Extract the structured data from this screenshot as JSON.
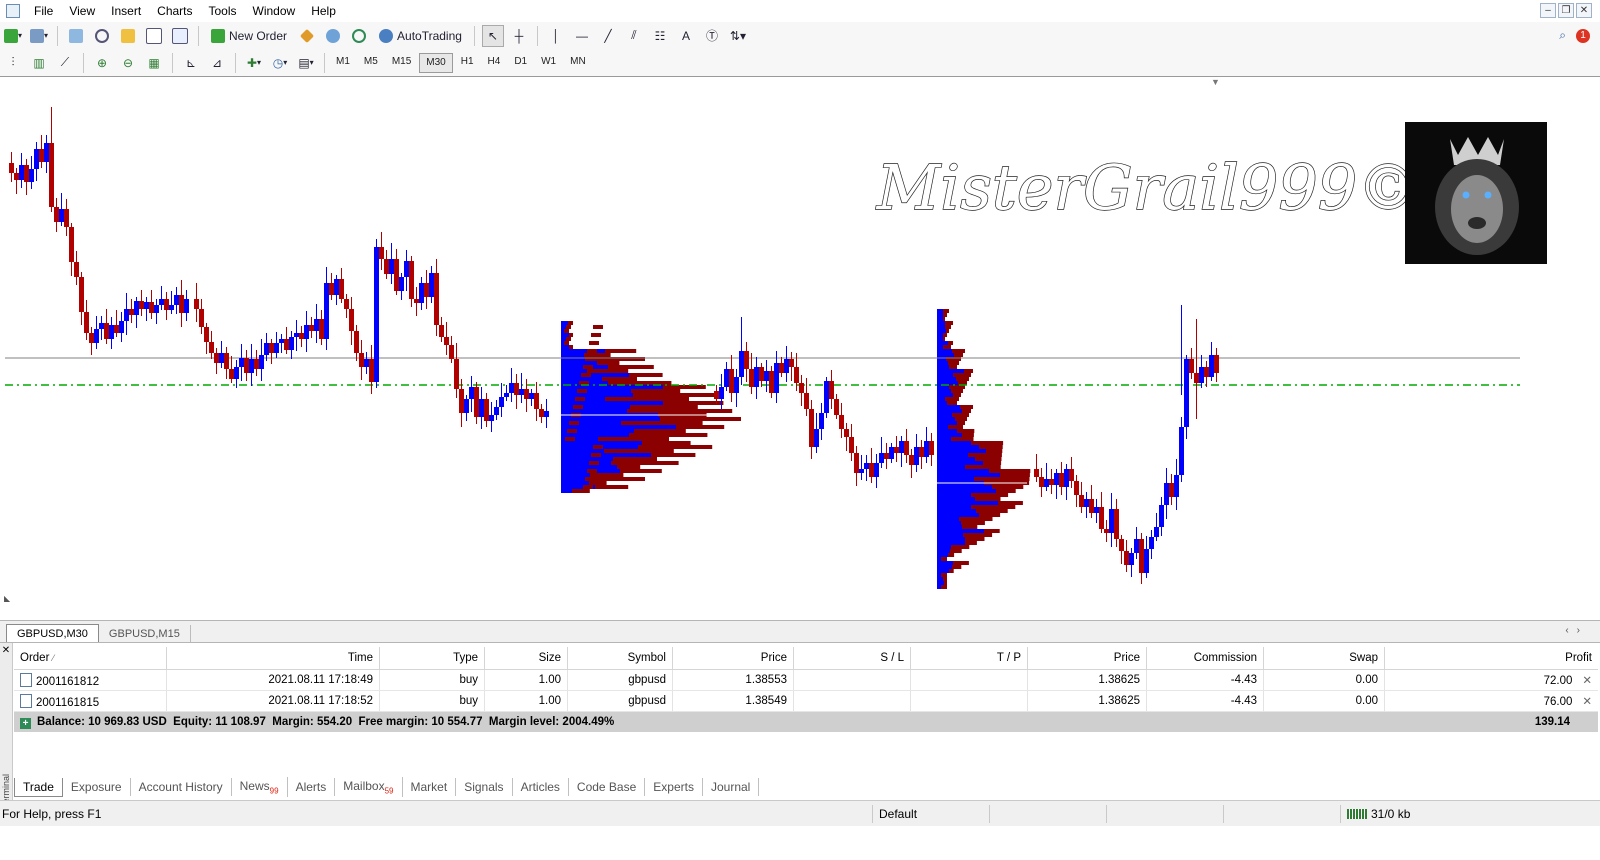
{
  "menu": {
    "items": [
      "File",
      "View",
      "Insert",
      "Charts",
      "Tools",
      "Window",
      "Help"
    ]
  },
  "toolbar": {
    "new_order_label": "New Order",
    "autotrading_label": "AutoTrading",
    "timeframes": [
      "M1",
      "M5",
      "M15",
      "M30",
      "H1",
      "H4",
      "D1",
      "W1",
      "MN"
    ],
    "active_timeframe": "M30",
    "notification_count": "1"
  },
  "chart": {
    "watermark_text": "MisterGrail999©",
    "logo": "lion-with-crown-icon",
    "colors": {
      "bull": "#0000ff",
      "bear": "#b00000",
      "profile_blue": "#0000ff",
      "profile_red": "#8b0000",
      "level_line": "#00aa00",
      "price_line": "#808080"
    }
  },
  "chart_tabs": [
    "GBPUSD,M30",
    "GBPUSD,M15"
  ],
  "terminal": {
    "side_label": "Terminal",
    "columns": [
      "Order",
      "Time",
      "Type",
      "Size",
      "Symbol",
      "Price",
      "S / L",
      "T / P",
      "Price",
      "Commission",
      "Swap",
      "Profit"
    ],
    "orders": [
      {
        "order": "2001161812",
        "time": "2021.08.11 17:18:49",
        "type": "buy",
        "size": "1.00",
        "symbol": "gbpusd",
        "price": "1.38553",
        "sl": "",
        "tp": "",
        "current_price": "1.38625",
        "commission": "-4.43",
        "swap": "0.00",
        "profit": "72.00"
      },
      {
        "order": "2001161815",
        "time": "2021.08.11 17:18:52",
        "type": "buy",
        "size": "1.00",
        "symbol": "gbpusd",
        "price": "1.38549",
        "sl": "",
        "tp": "",
        "current_price": "1.38625",
        "commission": "-4.43",
        "swap": "0.00",
        "profit": "76.00"
      }
    ],
    "balance_text": "Balance: 10 969.83 USD  Equity: 11 108.97  Margin: 554.20  Free margin: 10 554.77  Margin level: 2004.49%",
    "total_profit": "139.14",
    "tabs": [
      {
        "label": "Trade",
        "badge": ""
      },
      {
        "label": "Exposure",
        "badge": ""
      },
      {
        "label": "Account History",
        "badge": ""
      },
      {
        "label": "News",
        "badge": "99"
      },
      {
        "label": "Alerts",
        "badge": ""
      },
      {
        "label": "Mailbox",
        "badge": "59"
      },
      {
        "label": "Market",
        "badge": ""
      },
      {
        "label": "Signals",
        "badge": ""
      },
      {
        "label": "Articles",
        "badge": ""
      },
      {
        "label": "Code Base",
        "badge": ""
      },
      {
        "label": "Experts",
        "badge": ""
      },
      {
        "label": "Journal",
        "badge": ""
      }
    ]
  },
  "status": {
    "help": "For Help, press F1",
    "profile": "Default",
    "traffic": "31/0 kb"
  }
}
